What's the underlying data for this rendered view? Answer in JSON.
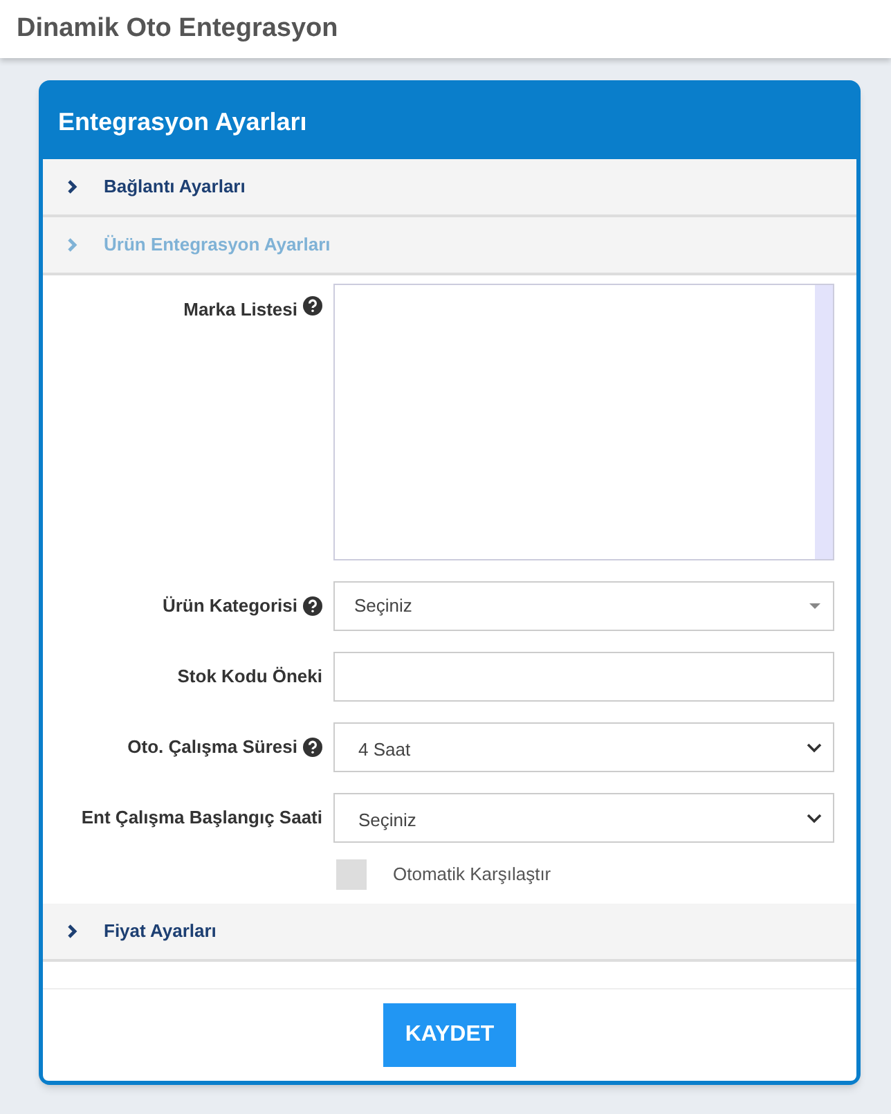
{
  "page_title": "Dinamik Oto Entegrasyon",
  "card": {
    "title": "Entegrasyon Ayarları",
    "sections": [
      {
        "title": "Bağlantı Ayarları",
        "expanded": false
      },
      {
        "title": "Ürün Entegrasyon Ayarları",
        "expanded": true,
        "fields": [
          {
            "kind": "textarea",
            "label": "Marka Listesi",
            "help": true
          },
          {
            "kind": "combo",
            "label": "Ürün Kategorisi",
            "help": true,
            "value": "Seçiniz"
          },
          {
            "kind": "input",
            "label": "Stok Kodu Öneki",
            "help": false
          },
          {
            "kind": "select",
            "label": "Oto. Çalışma Süresi",
            "help": true,
            "value": "4 Saat"
          },
          {
            "kind": "select",
            "label": "Ent Çalışma Başlangıç Saati",
            "help": false,
            "value": "Seçiniz"
          },
          {
            "kind": "checkbox",
            "label": "Otomatik Karşılaştır",
            "checked": false
          }
        ]
      },
      {
        "title": "Fiyat Ayarları",
        "expanded": false
      }
    ],
    "save_button": "KAYDET"
  }
}
